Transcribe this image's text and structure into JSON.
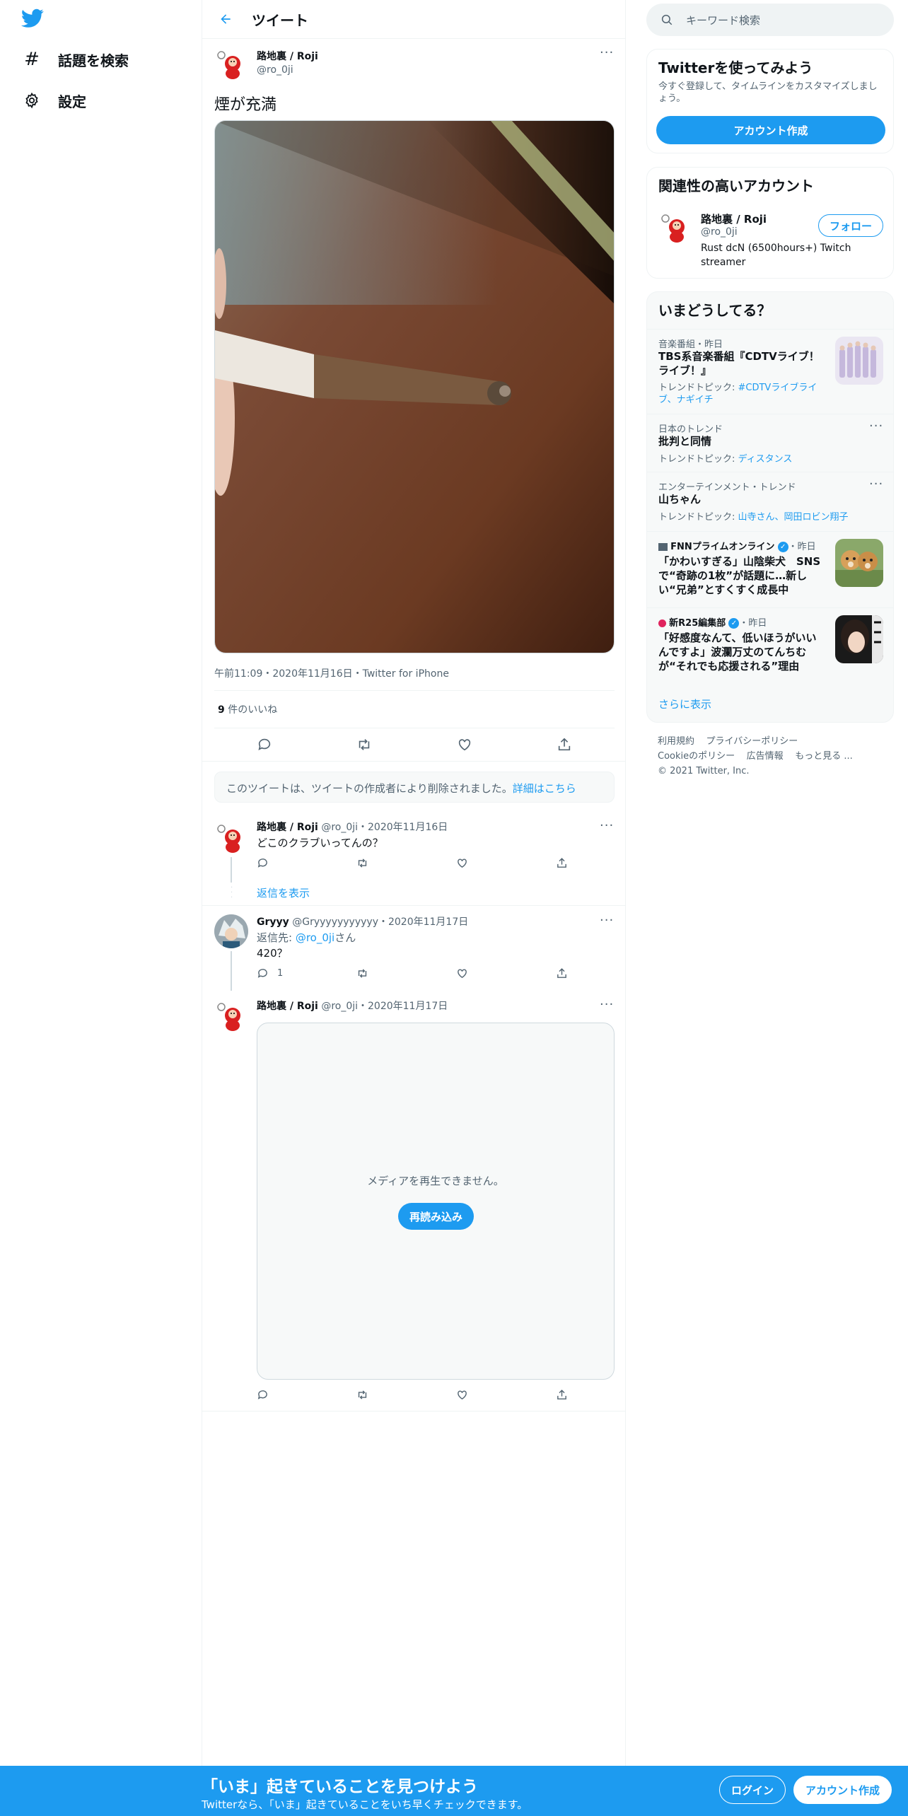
{
  "nav": {
    "explore_label": "話題を検索",
    "settings_label": "設定"
  },
  "header": {
    "title": "ツイート"
  },
  "tweet": {
    "name": "路地裏 / Roji",
    "handle": "@ro_0ji",
    "text": "煙が充満",
    "meta": "午前11:09・2020年11月16日・Twitter for iPhone",
    "likes_count": "9",
    "likes_label": " 件のいいね"
  },
  "deleted_notice": {
    "text": "このツイートは、ツイートの作成者により削除されました。",
    "link": "詳細はこちら"
  },
  "replies": [
    {
      "name": "路地裏 / Roji",
      "handle": "@ro_0ji",
      "date": "・2020年11月16日",
      "text": "どこのクラブいってんの？",
      "show_replies": "返信を表示"
    },
    {
      "name": "Gryyy",
      "handle": "@Gryyyyyyyyyyy",
      "date": "・2020年11月17日",
      "reply_to_label": "返信先: ",
      "reply_to_handle": "@ro_0ji",
      "reply_to_suffix": "さん",
      "text": "420？",
      "reply_count": "1"
    },
    {
      "name": "路地裏 / Roji",
      "handle": "@ro_0ji",
      "date": "・2020年11月17日",
      "media_error": "メディアを再生できません。",
      "reload_label": "再読み込み"
    }
  ],
  "right": {
    "search_placeholder": "キーワード検索",
    "signup_card": {
      "title": "Twitterを使ってみよう",
      "desc": "今すぐ登録して、タイムラインをカスタマイズしましょう。",
      "button": "アカウント作成"
    },
    "related": {
      "title": "関連性の高いアカウント",
      "name": "路地裏 / Roji",
      "handle": "@ro_0ji",
      "bio": "Rust dcN (6500hours+) Twitch streamer",
      "follow": "フォロー"
    },
    "trends": {
      "title": "いまどうしてる？",
      "items": [
        {
          "meta": "音楽番組・昨日",
          "title": "TBS系音楽番組『CDTVライブ！ライブ！』",
          "topic_label": "トレンドトピック: ",
          "topics": "#CDTVライブライブ、ナギイチ"
        },
        {
          "meta": "日本のトレンド",
          "title": "批判と同情",
          "topic_label": "トレンドトピック: ",
          "topics": "ディスタンス"
        },
        {
          "meta": "エンターテインメント・トレンド",
          "title": "山ちゃん",
          "topic_label": "トレンドトピック: ",
          "topics": "山寺さん、岡田ロビン翔子"
        },
        {
          "source": "FNNプライムオンライン",
          "time": "・昨日",
          "title": "「かわいすぎる」山陰柴犬　SNSで“奇跡の1枚”が話題に…新しい“兄弟”とすくすく成長中"
        },
        {
          "source": "新R25編集部",
          "time": "・昨日",
          "title": "「好感度なんて、低いほうがいいんですよ」波瀾万丈のてんちむが“それでも応援される”理由"
        }
      ],
      "show_more": "さらに表示"
    },
    "footer": {
      "terms": "利用規約",
      "privacy": "プライバシーポリシー",
      "cookie": "Cookieのポリシー",
      "ads": "広告情報",
      "more": "もっと見る ...",
      "copyright": "© 2021 Twitter, Inc."
    }
  },
  "bottom_bar": {
    "title": "「いま」起きていることを見つけよう",
    "subtitle": "Twitterなら、「いま」起きていることをいち早くチェックできます。",
    "login": "ログイン",
    "signup": "アカウント作成"
  },
  "colors": {
    "accent": "#1d9bf0",
    "text": "#0f1419",
    "muted": "#536471"
  }
}
